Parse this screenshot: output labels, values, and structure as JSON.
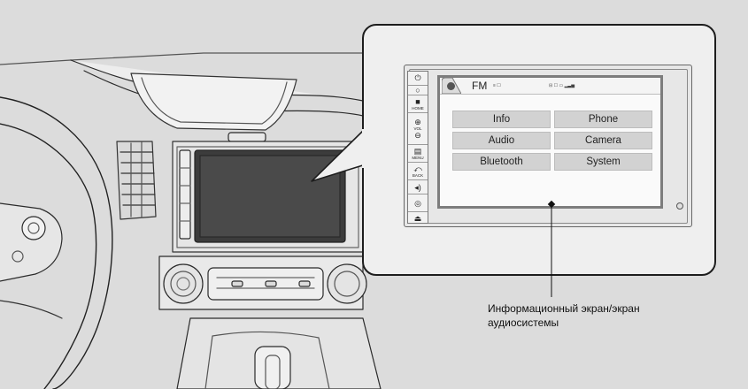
{
  "audio_unit": {
    "side_buttons": [
      {
        "icon": "power-icon",
        "glyph": "⏻",
        "label": ""
      },
      {
        "icon": "dot-icon",
        "glyph": "○",
        "label": ""
      },
      {
        "icon": "home-icon",
        "glyph": "■",
        "label": "HOME"
      },
      {
        "icon": "volume-icon",
        "glyph": "⊕",
        "label": "VOL"
      },
      {
        "icon": "menu-icon",
        "glyph": "▤",
        "label": "MENU"
      },
      {
        "icon": "back-icon",
        "glyph": "⤺",
        "label": "BACK"
      },
      {
        "icon": "sound-icon",
        "glyph": "◂)",
        "label": ""
      },
      {
        "icon": "selector-icon",
        "glyph": "◎",
        "label": ""
      },
      {
        "icon": "eject-icon",
        "glyph": "⏏",
        "label": ""
      }
    ],
    "status_bar": {
      "source": "FM",
      "station_small": "≡ ☐",
      "status_small": "⊟ ☐ ▭ ▂▃▅"
    },
    "menu_items": [
      {
        "label": "Info"
      },
      {
        "label": "Phone"
      },
      {
        "label": "Audio"
      },
      {
        "label": "Camera"
      },
      {
        "label": "Bluetooth"
      },
      {
        "label": "System"
      }
    ]
  },
  "caption": {
    "line1": "Информационный экран/экран",
    "line2": "аудиосистемы"
  }
}
